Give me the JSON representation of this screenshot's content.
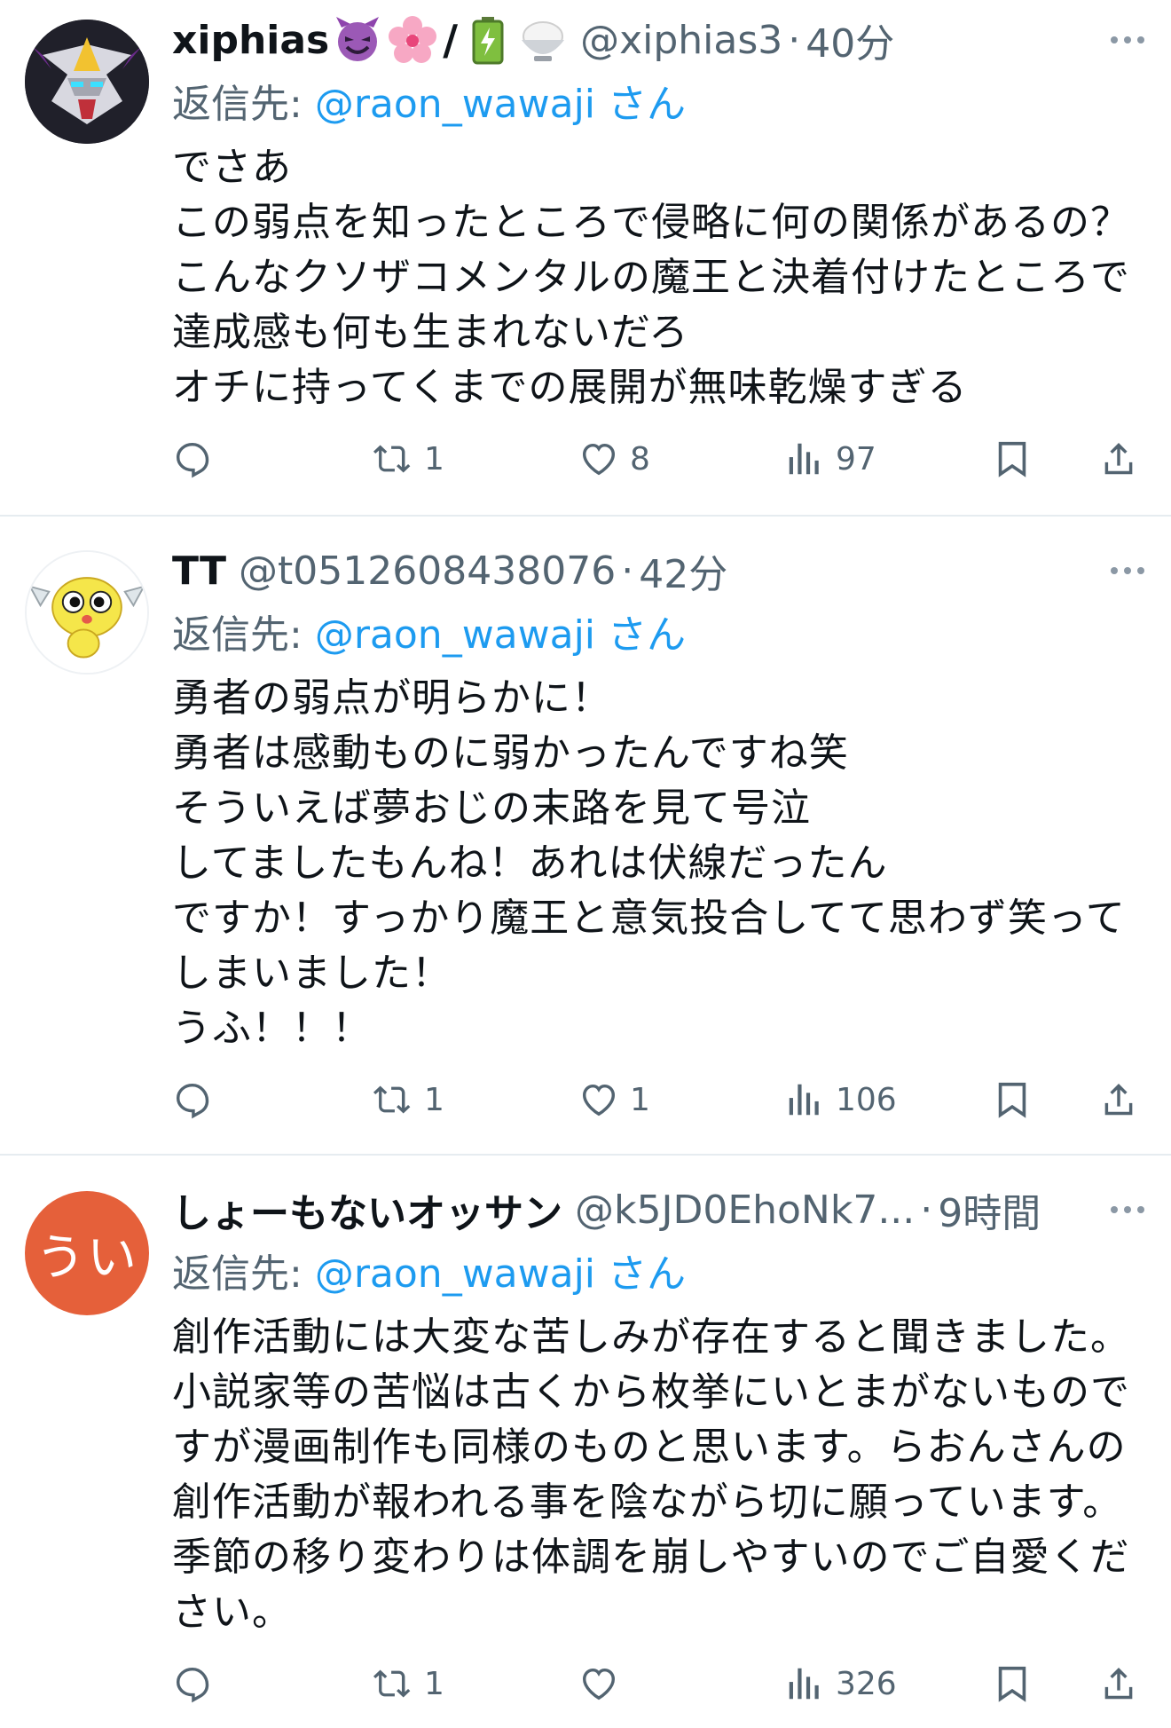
{
  "tweets": [
    {
      "display_name": "xiphias",
      "name_emojis": [
        "smiling-imp",
        "cherry-blossom",
        "slash",
        "battery",
        "rice-bowl"
      ],
      "handle": "@xiphias3",
      "time": "40分",
      "reply_label": "返信先:",
      "reply_mention": "@raon_wawaji さん",
      "text": "でさあ\nこの弱点を知ったところで侵略に何の関係があるの？\nこんなクソザコメンタルの魔王と決着付けたところで\n達成感も何も生まれないだろ\nオチに持ってくまでの展開が無味乾燥すぎる",
      "replies": "",
      "retweets": "1",
      "likes": "8",
      "views": "97",
      "avatar_icon": "robot-avatar-icon"
    },
    {
      "display_name": "TT",
      "handle": "@t0512608438076",
      "time": "42分",
      "reply_label": "返信先:",
      "reply_mention": "@raon_wawaji さん",
      "text": "勇者の弱点が明らかに！\n勇者は感動ものに弱かったんですね笑\nそういえば夢おじの末路を見て号泣\nしてましたもんね！あれは伏線だったん\nですか！すっかり魔王と意気投合してて思わず笑って\nしまいました！\nうふ！！！",
      "replies": "",
      "retweets": "1",
      "likes": "1",
      "views": "106",
      "avatar_icon": "yellow-mascot-avatar-icon"
    },
    {
      "display_name": "しょーもないオッサン",
      "handle": "@k5JD0EhoNk7...",
      "time": "9時間",
      "reply_label": "返信先:",
      "reply_mention": "@raon_wawaji さん",
      "avatar_text": "うい",
      "text": "創作活動には大変な苦しみが存在すると聞きました。\n小説家等の苦悩は古くから枚挙にいとまがないもので\nすが漫画制作も同様のものと思います。らおんさんの\n創作活動が報われる事を陰ながら切に願っています。\n季節の移り変わりは体調を崩しやすいのでご自愛くだ\nさい。",
      "replies": "",
      "retweets": "1",
      "likes": "",
      "views": "326",
      "avatar_color": "#e5603a"
    }
  ],
  "colors": {
    "link": "#1d9bf0",
    "secondary": "#536471",
    "text": "#0f1419",
    "divider": "#e6ecf0"
  }
}
